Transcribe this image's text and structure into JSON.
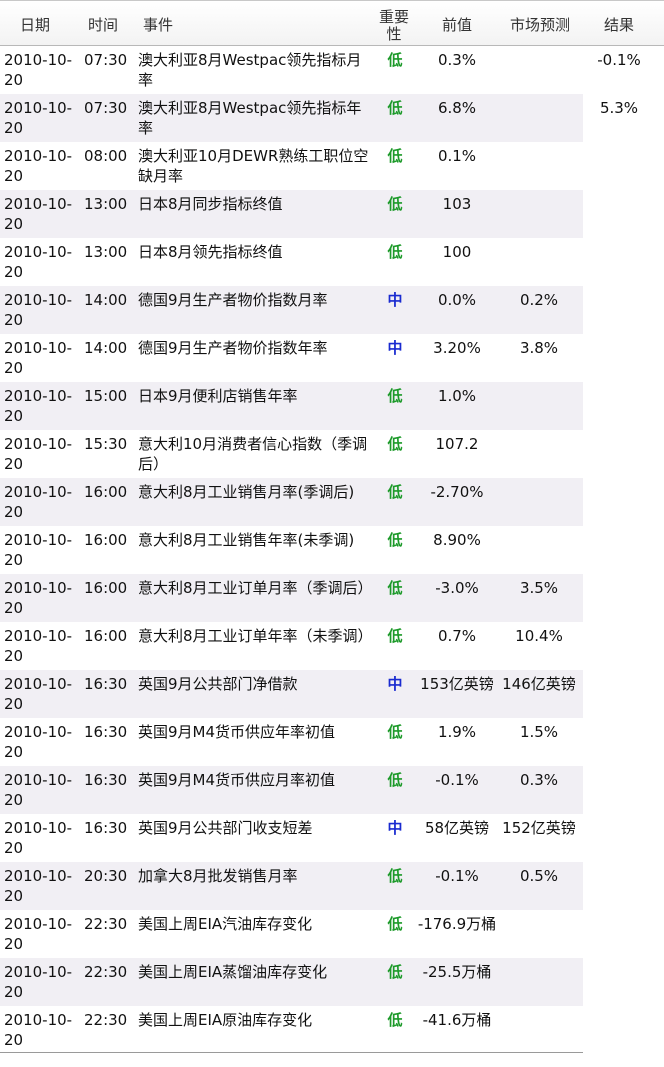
{
  "headers": {
    "date": "日期",
    "time": "时间",
    "event": "事件",
    "importance": "重要性",
    "previous": "前值",
    "forecast": "市场预测",
    "result": "结果"
  },
  "rows": [
    {
      "date": "2010-10-20",
      "time": "07:30",
      "event": "澳大利亚8月Westpac领先指标月率",
      "importance": "低",
      "level": "low",
      "previous": "0.3%",
      "forecast": "",
      "result": "-0.1%"
    },
    {
      "date": "2010-10-20",
      "time": "07:30",
      "event": "澳大利亚8月Westpac领先指标年率",
      "importance": "低",
      "level": "low",
      "previous": "6.8%",
      "forecast": "",
      "result": "5.3%"
    },
    {
      "date": "2010-10-20",
      "time": "08:00",
      "event": "澳大利亚10月DEWR熟练工职位空缺月率",
      "importance": "低",
      "level": "low",
      "previous": "0.1%",
      "forecast": "",
      "result": ""
    },
    {
      "date": "2010-10-20",
      "time": "13:00",
      "event": "日本8月同步指标终值",
      "importance": "低",
      "level": "low",
      "previous": "103",
      "forecast": "",
      "result": ""
    },
    {
      "date": "2010-10-20",
      "time": "13:00",
      "event": "日本8月领先指标终值",
      "importance": "低",
      "level": "low",
      "previous": "100",
      "forecast": "",
      "result": ""
    },
    {
      "date": "2010-10-20",
      "time": "14:00",
      "event": "德国9月生产者物价指数月率",
      "importance": "中",
      "level": "mid",
      "previous": "0.0%",
      "forecast": "0.2%",
      "result": ""
    },
    {
      "date": "2010-10-20",
      "time": "14:00",
      "event": "德国9月生产者物价指数年率",
      "importance": "中",
      "level": "mid",
      "previous": "3.20%",
      "forecast": "3.8%",
      "result": ""
    },
    {
      "date": "2010-10-20",
      "time": "15:00",
      "event": "日本9月便利店销售年率",
      "importance": "低",
      "level": "low",
      "previous": "1.0%",
      "forecast": "",
      "result": ""
    },
    {
      "date": "2010-10-20",
      "time": "15:30",
      "event": "意大利10月消费者信心指数（季调后）",
      "importance": "低",
      "level": "low",
      "previous": "107.2",
      "forecast": "",
      "result": ""
    },
    {
      "date": "2010-10-20",
      "time": "16:00",
      "event": "意大利8月工业销售月率(季调后)",
      "importance": "低",
      "level": "low",
      "previous": "-2.70%",
      "forecast": "",
      "result": ""
    },
    {
      "date": "2010-10-20",
      "time": "16:00",
      "event": "意大利8月工业销售年率(未季调)",
      "importance": "低",
      "level": "low",
      "previous": "8.90%",
      "forecast": "",
      "result": ""
    },
    {
      "date": "2010-10-20",
      "time": "16:00",
      "event": "意大利8月工业订单月率（季调后）",
      "importance": "低",
      "level": "low",
      "previous": "-3.0%",
      "forecast": "3.5%",
      "result": ""
    },
    {
      "date": "2010-10-20",
      "time": "16:00",
      "event": "意大利8月工业订单年率（未季调）",
      "importance": "低",
      "level": "low",
      "previous": "0.7%",
      "forecast": "10.4%",
      "result": ""
    },
    {
      "date": "2010-10-20",
      "time": "16:30",
      "event": "英国9月公共部门净借款",
      "importance": "中",
      "level": "mid",
      "previous": "153亿英镑",
      "forecast": "146亿英镑",
      "result": ""
    },
    {
      "date": "2010-10-20",
      "time": "16:30",
      "event": "英国9月M4货币供应年率初值",
      "importance": "低",
      "level": "low",
      "previous": "1.9%",
      "forecast": "1.5%",
      "result": ""
    },
    {
      "date": "2010-10-20",
      "time": "16:30",
      "event": "英国9月M4货币供应月率初值",
      "importance": "低",
      "level": "low",
      "previous": "-0.1%",
      "forecast": "0.3%",
      "result": ""
    },
    {
      "date": "2010-10-20",
      "time": "16:30",
      "event": "英国9月公共部门收支短差",
      "importance": "中",
      "level": "mid",
      "previous": "58亿英镑",
      "forecast": "152亿英镑",
      "result": ""
    },
    {
      "date": "2010-10-20",
      "time": "20:30",
      "event": "加拿大8月批发销售月率",
      "importance": "低",
      "level": "low",
      "previous": "-0.1%",
      "forecast": "0.5%",
      "result": ""
    },
    {
      "date": "2010-10-20",
      "time": "22:30",
      "event": "美国上周EIA汽油库存变化",
      "importance": "低",
      "level": "low",
      "previous": "-176.9万桶",
      "forecast": "",
      "result": ""
    },
    {
      "date": "2010-10-20",
      "time": "22:30",
      "event": "美国上周EIA蒸馏油库存变化",
      "importance": "低",
      "level": "low",
      "previous": "-25.5万桶",
      "forecast": "",
      "result": ""
    },
    {
      "date": "2010-10-20",
      "time": "22:30",
      "event": "美国上周EIA原油库存变化",
      "importance": "低",
      "level": "low",
      "previous": "-41.6万桶",
      "forecast": "",
      "result": ""
    }
  ]
}
